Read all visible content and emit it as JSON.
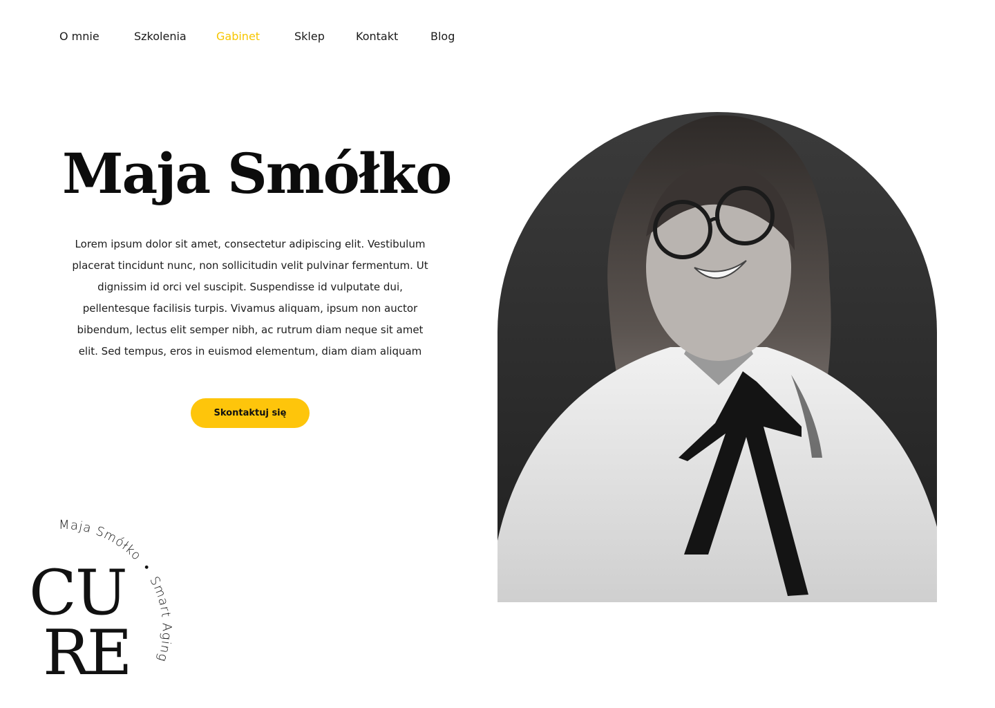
{
  "nav": {
    "items": [
      {
        "label": "O mnie",
        "active": false
      },
      {
        "label": "Szkolenia",
        "active": false
      },
      {
        "label": "Gabinet",
        "active": true
      },
      {
        "label": "Sklep",
        "active": false
      },
      {
        "label": "Kontakt",
        "active": false
      },
      {
        "label": "Blog",
        "active": false
      }
    ]
  },
  "hero": {
    "title": "Maja Smółko",
    "description_lines": [
      "Lorem ipsum dolor sit amet, consectetur adipiscing elit. Vestibulum",
      "placerat tincidunt nunc, non sollicitudin velit pulvinar fermentum. Ut",
      "dignissim id orci vel suscipit. Suspendisse id vulputate dui,",
      "pellentesque facilisis turpis. Vivamus aliquam, ipsum non auctor",
      "bibendum, lectus elit semper nibh, ac rutrum diam neque sit amet",
      "elit. Sed tempus, eros in euismod elementum, diam diam aliquam"
    ],
    "cta_label": "Skontaktuj się"
  },
  "logo": {
    "arc_text_1": "Maja Smółko",
    "arc_text_2": "Smart Aging",
    "separator": "•",
    "letters_top": "CU",
    "letters_bottom": "RE"
  },
  "colors": {
    "accent": "#fec50b",
    "active_nav": "#f7c600",
    "text": "#111111",
    "background": "#ffffff"
  }
}
